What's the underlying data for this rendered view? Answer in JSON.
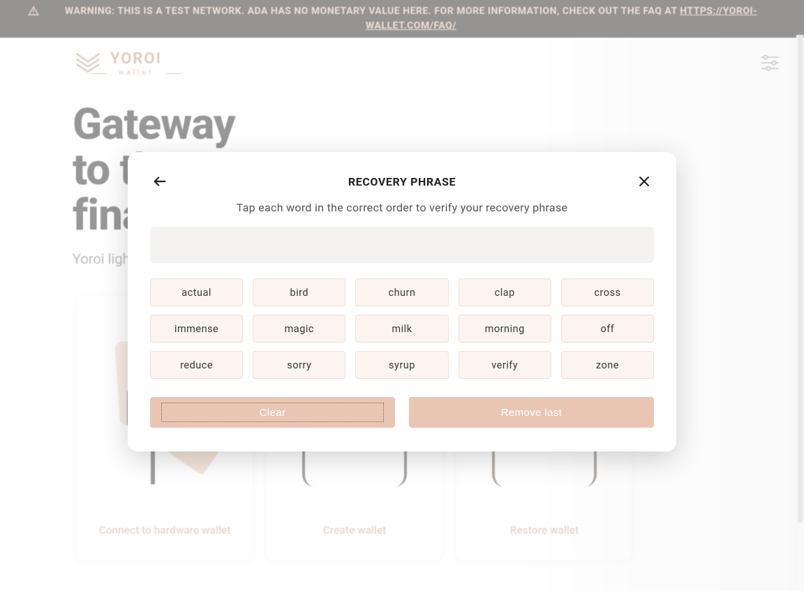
{
  "banner": {
    "prefix": "WARNING: THIS IS A TEST NETWORK. ADA HAS NO MONETARY VALUE HERE. FOR MORE INFORMATION, CHECK OUT THE FAQ AT ",
    "link_text": "HTTPS://YOROI-WALLET.COM/FAQ/"
  },
  "brand": {
    "name": "YOROI",
    "tagline": "wallet"
  },
  "hero": {
    "line1": "Gateway",
    "line2": "to the",
    "line3": "financial world",
    "subtitle": "Yoroi light wallet for Cardano assets"
  },
  "cards": [
    {
      "label": "Connect to hardware wallet"
    },
    {
      "label": "Create wallet"
    },
    {
      "label": "Restore wallet"
    }
  ],
  "modal": {
    "title": "RECOVERY PHRASE",
    "subtitle": "Tap each word in the correct order to verify your recovery phrase",
    "words": [
      "actual",
      "bird",
      "churn",
      "clap",
      "cross",
      "immense",
      "magic",
      "milk",
      "morning",
      "off",
      "reduce",
      "sorry",
      "syrup",
      "verify",
      "zone"
    ],
    "clear_label": "Clear",
    "remove_label": "Remove last"
  },
  "colors": {
    "accent": "#c9a890",
    "banner_bg": "#17120f",
    "banner_fg": "#d6b8a8",
    "chip_bg": "#fbf4f0",
    "btn_bg": "#e9c6b4"
  }
}
